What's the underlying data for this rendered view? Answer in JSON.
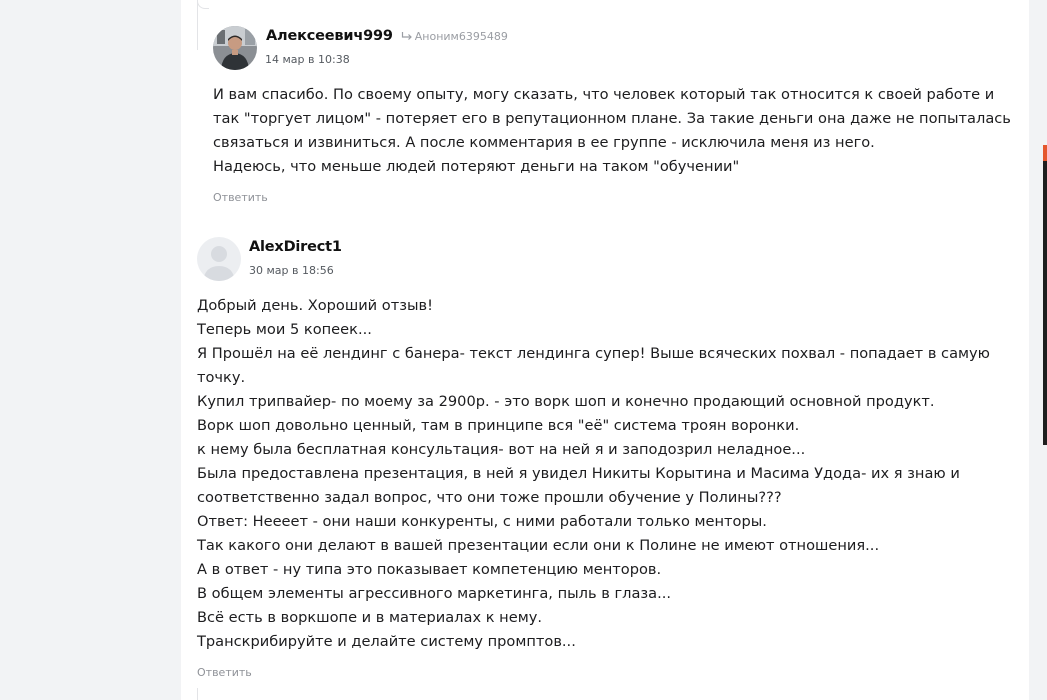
{
  "comments": [
    {
      "author": "Алексеевич999",
      "reply_to": "Аноним6395489",
      "timestamp": "14 мар в 10:38",
      "lines": [
        "И вам спасибо. По своему опыту, могу сказать, что человек который так относится к своей работе и",
        "так \"торгует лицом\" - потеряет его в репутационном плане. За такие деньги она даже не попыталась",
        "связаться и извиниться. А после комментария в ее группе - исключила меня из него.",
        "Надеюсь, что меньше людей потеряют деньги на таком \"обучении\""
      ],
      "reply_label": "Ответить",
      "avatar_icon": "user-photo-avatar"
    },
    {
      "author": "AlexDirect1",
      "timestamp": "30 мар в 18:56",
      "lines": [
        "Добрый день. Хороший отзыв!",
        "Теперь мои 5 копеек...",
        "Я Прошёл на её лендинг с банера- текст лендинга супер! Выше всяческих похвал - попадает в самую",
        "точку.",
        "Купил трипвайер- по моему за 2900р. - это ворк шоп и конечно продающий основной продукт.",
        "Ворк шоп довольно ценный, там в принципе вся \"её\" система троян воронки.",
        "к нему была бесплатная консультация- вот на ней я и заподозрил неладное...",
        "Была предоставлена презентация, в ней я увидел Никиты Корытина и Масима Удода- их я знаю и",
        "соответственно задал вопрос, что они тоже прошли обучение у Полины???",
        "Ответ: Нееeет - они наши конкуренты, с ними работали только менторы.",
        "Так какого они делают в вашей презентации если они к Полине не имеют отношения...",
        "А в ответ - ну типа это показывает компетенцию менторов.",
        "В общем элементы агрессивного маркетинга, пыль в глаза...",
        "Всё есть в воркшопе и в материалах к нему.",
        "Транскрибируйте и делайте систему промптов..."
      ],
      "reply_label": "Ответить",
      "avatar_icon": "default-user-avatar"
    }
  ],
  "icons": {
    "reply_arrow": "reply-arrow-icon"
  },
  "colors": {
    "page_background": "#f2f3f5",
    "card_background": "#ffffff",
    "text": "#1d1d1f",
    "muted": "#8f9298",
    "scroll_accent": "#e4572e"
  }
}
